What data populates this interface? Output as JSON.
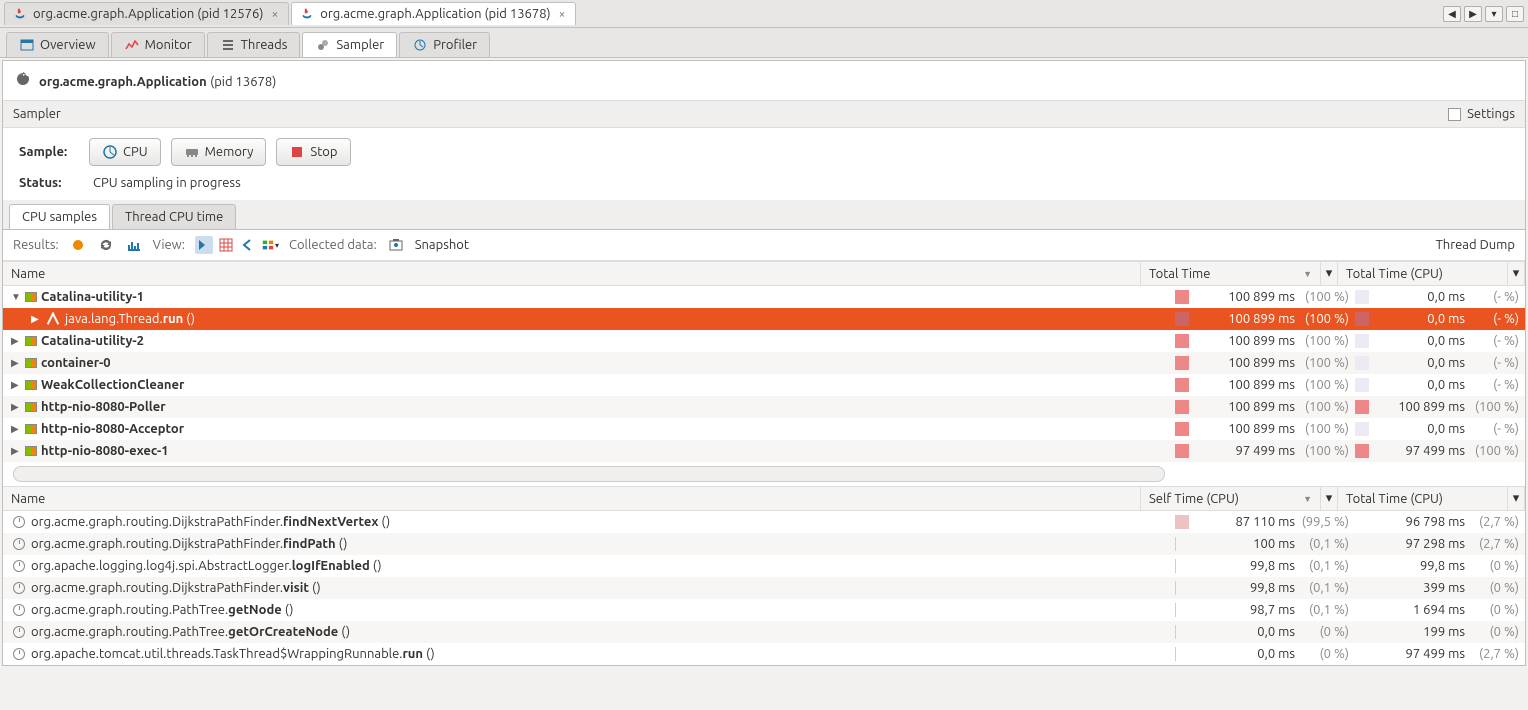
{
  "app_tabs": [
    {
      "label": "org.acme.graph.Application (pid 12576)",
      "active": false
    },
    {
      "label": "org.acme.graph.Application (pid 13678)",
      "active": true
    }
  ],
  "sub_tabs": [
    {
      "label": "Overview",
      "icon": "overview"
    },
    {
      "label": "Monitor",
      "icon": "monitor"
    },
    {
      "label": "Threads",
      "icon": "threads"
    },
    {
      "label": "Sampler",
      "icon": "sampler",
      "active": true
    },
    {
      "label": "Profiler",
      "icon": "profiler"
    }
  ],
  "page_title_app": "org.acme.graph.Application",
  "page_title_pid": "(pid 13678)",
  "section_name": "Sampler",
  "settings_label": "Settings",
  "sample_label": "Sample:",
  "buttons": {
    "cpu": "CPU",
    "memory": "Memory",
    "stop": "Stop"
  },
  "status_label": "Status:",
  "status_value": "CPU sampling in progress",
  "inner_tabs": [
    {
      "label": "CPU samples",
      "active": true
    },
    {
      "label": "Thread CPU time"
    }
  ],
  "toolbar": {
    "results": "Results:",
    "view": "View:",
    "collected": "Collected data:",
    "snapshot": "Snapshot",
    "thread_dump": "Thread Dump"
  },
  "tree_headers": {
    "name": "Name",
    "total_time": "Total Time",
    "total_cpu": "Total Time (CPU)"
  },
  "tree_rows": [
    {
      "indent": 0,
      "exp": "▼",
      "ico": "thread",
      "b": "Catalina-utility-1",
      "tt": "100 899 ms",
      "ttp": "(100 %)",
      "tc": "0,0 ms",
      "tcp": "(- %)"
    },
    {
      "indent": 1,
      "exp": "▶",
      "ico": "method",
      "pre": "java.lang.Thread.",
      "b": "run",
      "suf": " ()",
      "tt": "100 899 ms",
      "ttp": "(100 %)",
      "tc": "0,0 ms",
      "tcp": "(- %)",
      "selected": true
    },
    {
      "indent": 0,
      "exp": "▶",
      "ico": "thread",
      "b": "Catalina-utility-2",
      "tt": "100 899 ms",
      "ttp": "(100 %)",
      "tc": "0,0 ms",
      "tcp": "(- %)"
    },
    {
      "indent": 0,
      "exp": "▶",
      "ico": "thread",
      "b": "container-0",
      "tt": "100 899 ms",
      "ttp": "(100 %)",
      "tc": "0,0 ms",
      "tcp": "(- %)"
    },
    {
      "indent": 0,
      "exp": "▶",
      "ico": "thread",
      "b": "WeakCollectionCleaner",
      "tt": "100 899 ms",
      "ttp": "(100 %)",
      "tc": "0,0 ms",
      "tcp": "(- %)"
    },
    {
      "indent": 0,
      "exp": "▶",
      "ico": "thread",
      "b": "http-nio-8080-Poller",
      "tt": "100 899 ms",
      "ttp": "(100 %)",
      "tc": "100 899 ms",
      "tcp": "(100 %)",
      "cpu_bar": true
    },
    {
      "indent": 0,
      "exp": "▶",
      "ico": "thread",
      "b": "http-nio-8080-Acceptor",
      "tt": "100 899 ms",
      "ttp": "(100 %)",
      "tc": "0,0 ms",
      "tcp": "(- %)"
    },
    {
      "indent": 0,
      "exp": "▶",
      "ico": "thread",
      "b": "http-nio-8080-exec-1",
      "tt": "97 499 ms",
      "ttp": "(100 %)",
      "tc": "97 499 ms",
      "tcp": "(100 %)",
      "cpu_bar": true
    }
  ],
  "hot_headers": {
    "name": "Name",
    "self": "Self Time (CPU)",
    "total": "Total Time (CPU)"
  },
  "hot_rows": [
    {
      "pre": "org.acme.graph.routing.DijkstraPathFinder.",
      "b": "findNextVertex",
      "suf": " ()",
      "s": "87 110 ms",
      "sp": "(99,5 %)",
      "t": "96 798 ms",
      "tp": "(2,7 %)",
      "bar": 100
    },
    {
      "pre": "org.acme.graph.routing.DijkstraPathFinder.",
      "b": "findPath",
      "suf": " ()",
      "s": "100 ms",
      "sp": "(0,1 %)",
      "t": "97 298 ms",
      "tp": "(2,7 %)",
      "bar": 1
    },
    {
      "pre": "org.apache.logging.log4j.spi.AbstractLogger.",
      "b": "logIfEnabled",
      "suf": " ()",
      "s": "99,8 ms",
      "sp": "(0,1 %)",
      "t": "99,8 ms",
      "tp": "(0 %)",
      "bar": 1
    },
    {
      "pre": "org.acme.graph.routing.DijkstraPathFinder.",
      "b": "visit",
      "suf": " ()",
      "s": "99,8 ms",
      "sp": "(0,1 %)",
      "t": "399 ms",
      "tp": "(0 %)",
      "bar": 1
    },
    {
      "pre": "org.acme.graph.routing.PathTree.",
      "b": "getNode",
      "suf": " ()",
      "s": "98,7 ms",
      "sp": "(0,1 %)",
      "t": "1 694 ms",
      "tp": "(0 %)",
      "bar": 1
    },
    {
      "pre": "org.acme.graph.routing.PathTree.",
      "b": "getOrCreateNode",
      "suf": " ()",
      "s": "0,0 ms",
      "sp": "(0 %)",
      "t": "199 ms",
      "tp": "(0 %)",
      "bar": 0
    },
    {
      "pre": "org.apache.tomcat.util.threads.TaskThread$WrappingRunnable.",
      "b": "run",
      "suf": " ()",
      "s": "0,0 ms",
      "sp": "(0 %)",
      "t": "97 499 ms",
      "tp": "(2,7 %)",
      "bar": 0
    }
  ]
}
